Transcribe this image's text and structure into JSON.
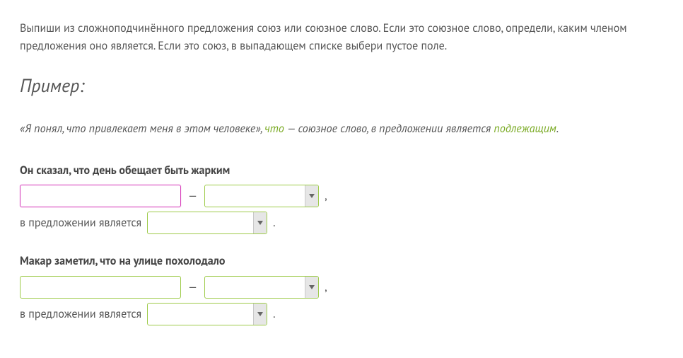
{
  "instructions": "Выпиши из сложноподчинённого предложения союз или союзное слово. Если это союзное слово, определи, каким членом предложения оно является. Если это союз, в выпадающем списке выбери пустое поле.",
  "example": {
    "heading": "Пример:",
    "quote": "«Я понял, что привлекает меня в этом человеке», ",
    "word": "что",
    "mid": " — союзное слово, в предложении является ",
    "role": "подлежащим",
    "end": "."
  },
  "labels": {
    "dash": "—",
    "comma": ",",
    "period": ".",
    "role_prefix": "в предложении является"
  },
  "tasks": [
    {
      "sentence": "Он сказал, что день обещает быть жарким",
      "input_value": "",
      "input_focused": true,
      "type_value": "",
      "role_value": ""
    },
    {
      "sentence": "Макар заметил, что на улице похолодало",
      "input_value": "",
      "input_focused": false,
      "type_value": "",
      "role_value": ""
    }
  ]
}
